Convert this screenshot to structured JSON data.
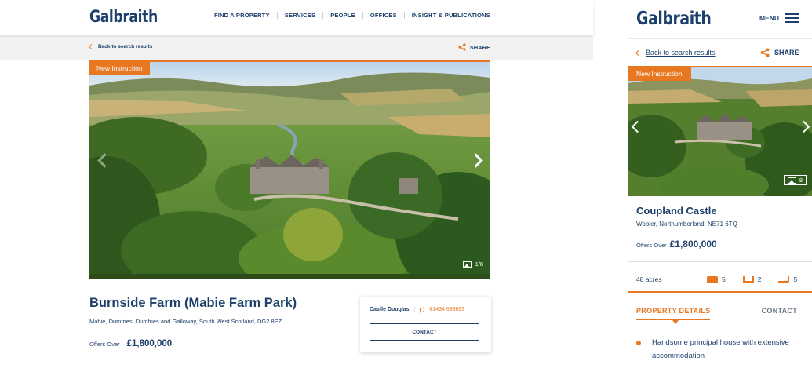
{
  "brand": {
    "name": "Galbraith",
    "accent_color": "#e87722",
    "text_color": "#1d3f6b"
  },
  "desktop": {
    "nav": [
      {
        "label": "FIND A PROPERTY"
      },
      {
        "label": "SERVICES"
      },
      {
        "label": "PEOPLE"
      },
      {
        "label": "OFFICES"
      },
      {
        "label": "INSIGHT & PUBLICATIONS"
      }
    ],
    "back_label": "Back to search results",
    "share_label": "SHARE",
    "badge": "New Instruction",
    "image_counter": "1/8",
    "title": "Burnside Farm (Mabie Farm Park)",
    "address": "Mabie, Dumfries, Dumfries and Galloway, South West Scotland, DG2 8EZ",
    "price_prefix": "Offers Over",
    "price": "£1,800,000",
    "contact": {
      "office": "Castle Douglas",
      "separator": "|",
      "phone": "01434 693693",
      "button_label": "CONTACT"
    }
  },
  "mobile": {
    "menu_label": "MENU",
    "back_label": "Back to search results",
    "share_label": "SHARE",
    "badge": "New Instruction",
    "image_counter": "8",
    "title": "Coupland Castle",
    "address": "Wooler, Northumberland, NE71 6TQ",
    "price_prefix": "Offers Over",
    "price": "£1,800,000",
    "stats": {
      "acres": "48 acres",
      "bedrooms": "5",
      "bathrooms": "2",
      "receptions": "5"
    },
    "tabs": [
      {
        "label": "PROPERTY DETAILS"
      },
      {
        "label": "CONTACT"
      }
    ],
    "features": [
      "Handsome principal house with extensive accommodation"
    ]
  },
  "icons": {
    "back": "chevron-left-icon",
    "share": "share-icon",
    "next": "chevron-right-icon",
    "prev": "chevron-left-icon",
    "gallery": "image-icon",
    "phone": "phone-icon",
    "menu": "hamburger-icon",
    "bed": "bed-icon",
    "bath": "bath-icon",
    "reception": "sofa-icon"
  }
}
